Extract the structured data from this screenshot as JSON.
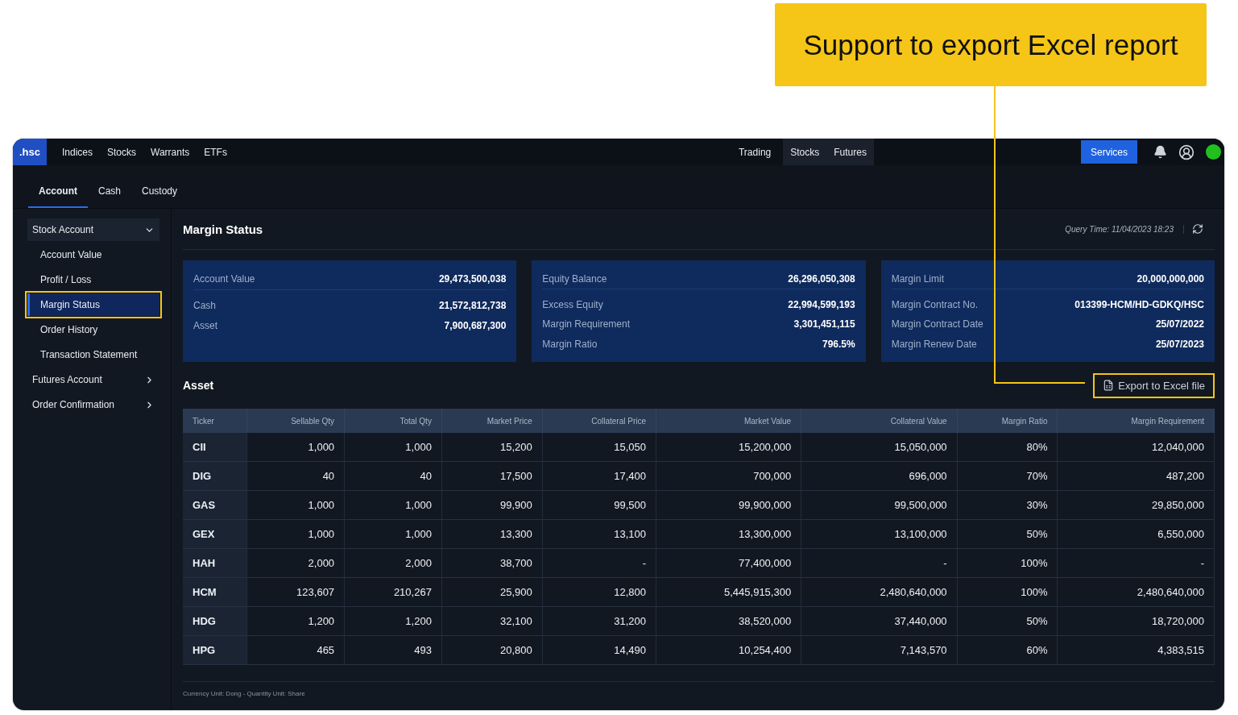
{
  "callout": {
    "text": "Support to export Excel report"
  },
  "topbar": {
    "logo": ".hsc",
    "nav": [
      "Indices",
      "Stocks",
      "Warrants",
      "ETFs"
    ],
    "mode_label": "Trading",
    "segments": [
      "Stocks",
      "Futures"
    ],
    "services": "Services"
  },
  "subtabs": [
    {
      "label": "Account",
      "selected": true
    },
    {
      "label": "Cash",
      "selected": false
    },
    {
      "label": "Custody",
      "selected": false
    }
  ],
  "sidebar": [
    {
      "label": "Stock Account",
      "expanded": true,
      "children": [
        {
          "label": "Account Value",
          "selected": false,
          "annotated": false
        },
        {
          "label": "Profit / Loss",
          "selected": false,
          "annotated": false
        },
        {
          "label": "Margin Status",
          "selected": true,
          "annotated": true
        },
        {
          "label": "Order History",
          "selected": false,
          "annotated": false
        },
        {
          "label": "Transaction Statement",
          "selected": false,
          "annotated": false
        }
      ]
    },
    {
      "label": "Futures Account",
      "expanded": false
    },
    {
      "label": "Order Confirmation",
      "expanded": false
    }
  ],
  "page_title": "Margin Status",
  "query_time": "Query Time: 11/04/2023 18:23",
  "summary_cards": [
    {
      "rows": [
        {
          "label": "Account Value",
          "value": "29,473,500,038"
        },
        {
          "label": "Cash",
          "value": "21,572,812,738"
        },
        {
          "label": "Asset",
          "value": "7,900,687,300"
        }
      ]
    },
    {
      "rows": [
        {
          "label": "Equity Balance",
          "value": "26,296,050,308"
        },
        {
          "label": "Excess Equity",
          "value": "22,994,599,193"
        },
        {
          "label": "Margin Requirement",
          "value": "3,301,451,115"
        },
        {
          "label": "Margin Ratio",
          "value": "796.5%"
        }
      ]
    },
    {
      "rows": [
        {
          "label": "Margin Limit",
          "value": "20,000,000,000"
        },
        {
          "label": "Margin Contract No.",
          "value": "013399-HCM/HD-GDKQ/HSC"
        },
        {
          "label": "Margin Contract Date",
          "value": "25/07/2022"
        },
        {
          "label": "Margin Renew Date",
          "value": "25/07/2023"
        }
      ]
    }
  ],
  "asset": {
    "title": "Asset",
    "export_button": {
      "label": "Export to Excel file",
      "annotated": true
    }
  },
  "table": {
    "columns": [
      "Ticker",
      "Sellable Qty",
      "Total Qty",
      "Market Price",
      "Collateral Price",
      "Market Value",
      "Collateral Value",
      "Margin Ratio",
      "Margin Requirement"
    ],
    "rows": [
      [
        "CII",
        "1,000",
        "1,000",
        "15,200",
        "15,050",
        "15,200,000",
        "15,050,000",
        "80%",
        "12,040,000"
      ],
      [
        "DIG",
        "40",
        "40",
        "17,500",
        "17,400",
        "700,000",
        "696,000",
        "70%",
        "487,200"
      ],
      [
        "GAS",
        "1,000",
        "1,000",
        "99,900",
        "99,500",
        "99,900,000",
        "99,500,000",
        "30%",
        "29,850,000"
      ],
      [
        "GEX",
        "1,000",
        "1,000",
        "13,300",
        "13,100",
        "13,300,000",
        "13,100,000",
        "50%",
        "6,550,000"
      ],
      [
        "HAH",
        "2,000",
        "2,000",
        "38,700",
        "-",
        "77,400,000",
        "-",
        "100%",
        "-"
      ],
      [
        "HCM",
        "123,607",
        "210,267",
        "25,900",
        "12,800",
        "5,445,915,300",
        "2,480,640,000",
        "100%",
        "2,480,640,000"
      ],
      [
        "HDG",
        "1,200",
        "1,200",
        "32,100",
        "31,200",
        "38,520,000",
        "37,440,000",
        "50%",
        "18,720,000"
      ],
      [
        "HPG",
        "465",
        "493",
        "20,800",
        "14,490",
        "10,254,400",
        "7,143,570",
        "60%",
        "4,383,515"
      ]
    ]
  },
  "footnote": "Currency Unit: Dong - Quantity Unit: Share"
}
